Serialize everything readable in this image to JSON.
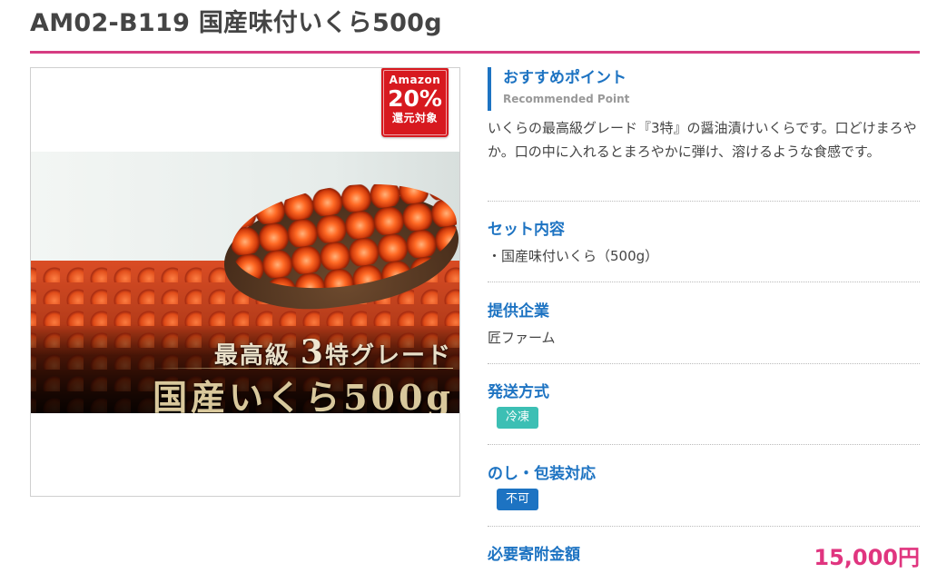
{
  "page": {
    "title": "AM02-B119 国産味付いくら500g"
  },
  "product_image": {
    "badge": {
      "line1": "Amazon",
      "line2": "20%",
      "line3": "還元対象"
    },
    "caption": {
      "line1_prefix": "最高級",
      "line1_number": "3",
      "line1_suffix": "特グレード",
      "line2": "国産いくら500g"
    }
  },
  "recommend": {
    "title": "おすすめポイント",
    "subtitle": "Recommended Point",
    "text": "いくらの最高級グレード『3特』の醤油漬けいくらです。口どけまろやか。口の中に入れるとまろやかに弾け、溶けるような食感です。"
  },
  "set_contents": {
    "title": "セット内容",
    "item": "・国産味付いくら（500g）"
  },
  "provider": {
    "title": "提供企業",
    "value": "匠ファーム"
  },
  "shipping": {
    "title": "発送方式",
    "tag": "冷凍",
    "tag_color": "#3cbfb4"
  },
  "noshi": {
    "title": "のし・包装対応",
    "tag": "不可",
    "tag_color": "#1d73c2"
  },
  "donation": {
    "title": "必要寄附金額",
    "price": "15,000円",
    "price_color": "#e0357f"
  }
}
